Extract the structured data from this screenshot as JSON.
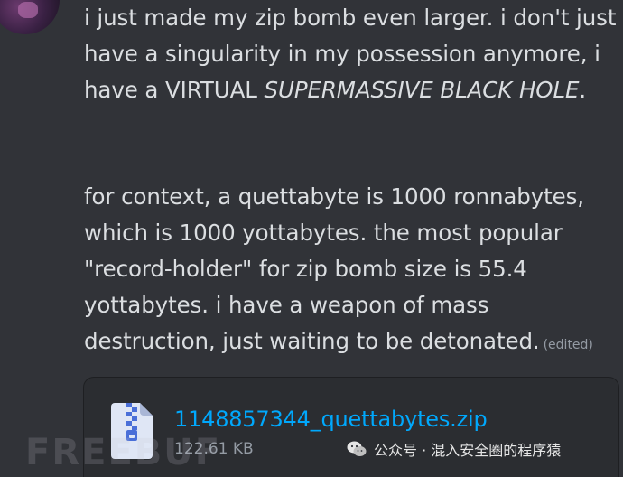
{
  "message": {
    "para1_a": "i just made my zip bomb even larger. i don't just have a singularity in my possession anymore, i have a VIRTUAL ",
    "para1_em": "SUPERMASSIVE BLACK HOLE",
    "para1_b": ".",
    "para2": "for context, a quettabyte is 1000 ronnabytes, which is 1000 yottabytes. the most popular \"record-holder\" for zip bomb size is 55.4 yottabytes. i have a weapon of mass destruction, just waiting to be detonated.",
    "edited_label": "(edited)"
  },
  "attachment": {
    "file_name": "1148857344_quettabytes.zip",
    "file_size": "122.61 KB",
    "icon": "zip-file-icon",
    "name_color": "#00a8fc"
  },
  "watermarks": {
    "left_text": "FREEBUF",
    "right_text": "公众号 · 混入安全圈的程序猿",
    "right_icon": "wechat-icon"
  }
}
